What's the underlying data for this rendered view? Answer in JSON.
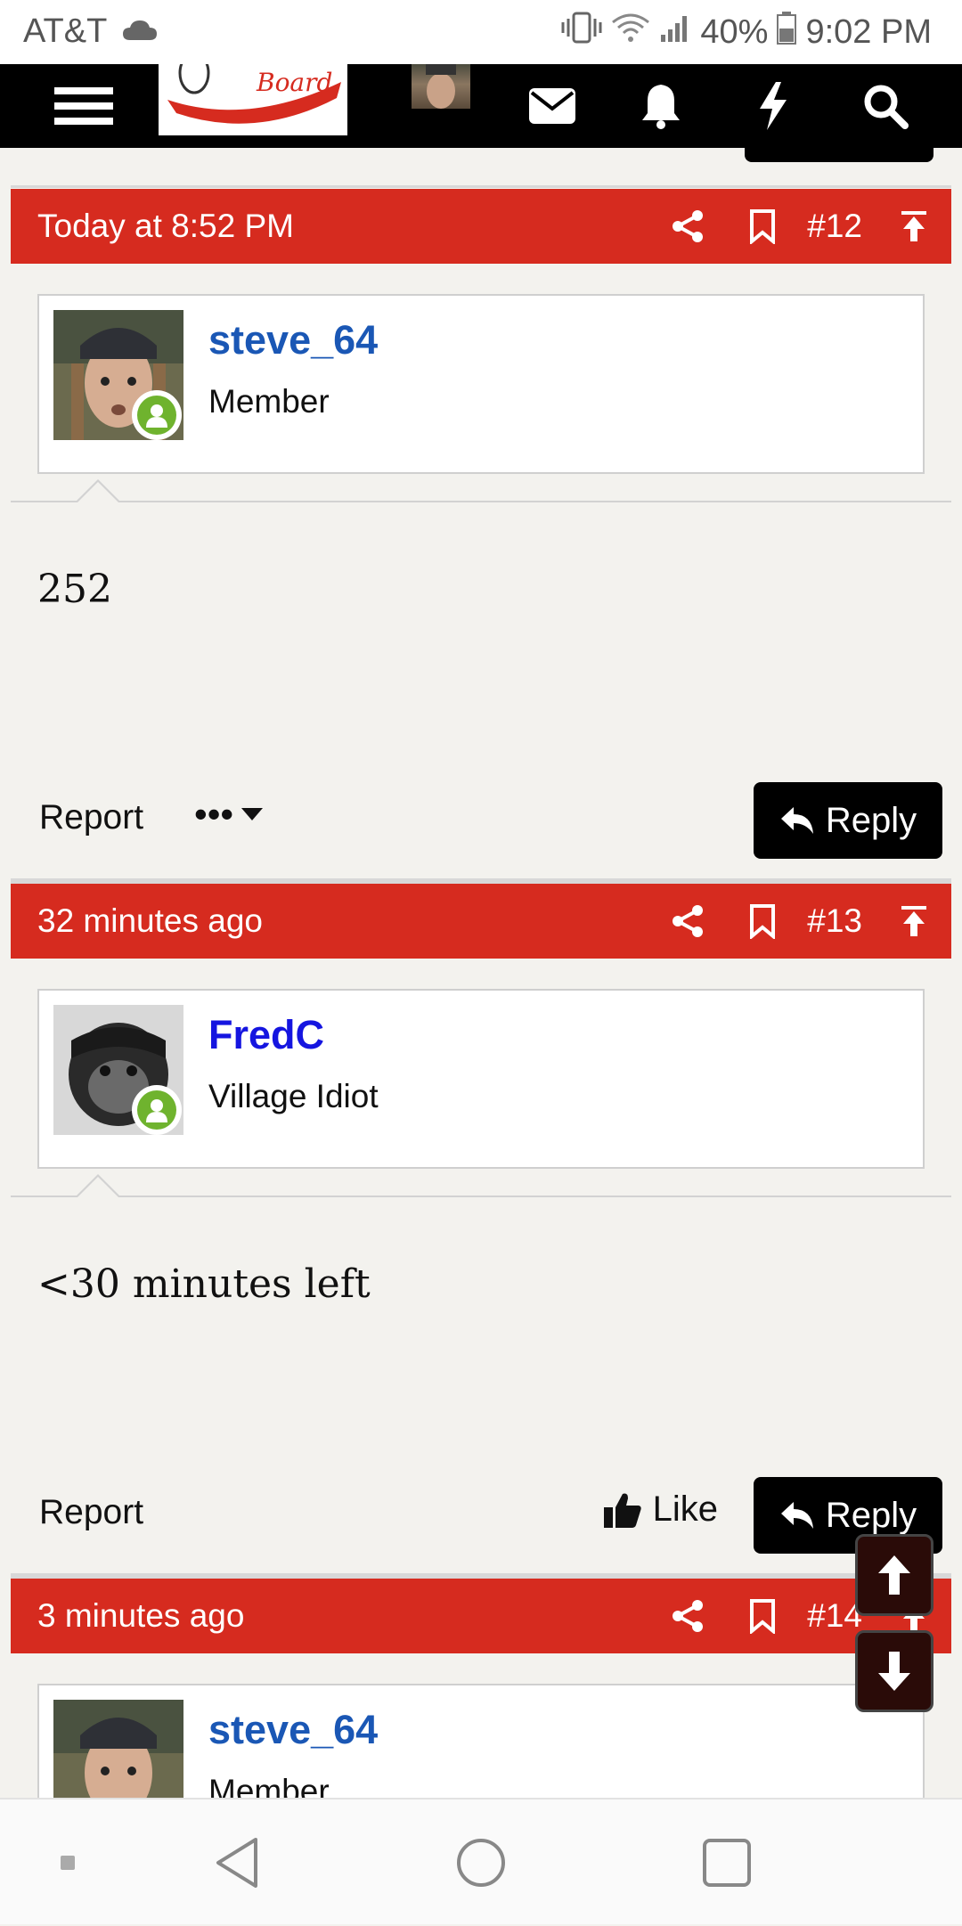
{
  "status_bar": {
    "carrier": "AT&T",
    "battery": "40%",
    "time": "9:02 PM",
    "icons": [
      "cloud-icon",
      "vibrate-icon",
      "wifi-icon",
      "signal-icon",
      "battery-icon"
    ]
  },
  "nav": {
    "icons": [
      "menu-icon",
      "site-logo",
      "user-avatar",
      "mail-icon",
      "bell-icon",
      "bolt-icon",
      "search-icon"
    ],
    "logo_text": "Board"
  },
  "posts": [
    {
      "timestamp": "Today at 8:52 PM",
      "number": "#12",
      "username": "steve_64",
      "user_title": "Member",
      "username_color": "#1a57b5",
      "body": "252",
      "report_label": "Report",
      "more_label": "•••",
      "reply_label": "Reply"
    },
    {
      "timestamp": "32 minutes ago",
      "number": "#13",
      "username": "FredC",
      "user_title": "Village Idiot",
      "username_color": "#1515e0",
      "body": "<30 minutes left",
      "report_label": "Report",
      "like_label": "Like",
      "reply_label": "Reply"
    },
    {
      "timestamp": "3 minutes ago",
      "number": "#14",
      "username": "steve_64",
      "user_title": "Member",
      "username_color": "#1a57b5"
    }
  ],
  "colors": {
    "header_red": "#d62b1f",
    "online_green": "#6fb32e",
    "page_bg": "#f3f2ee"
  }
}
